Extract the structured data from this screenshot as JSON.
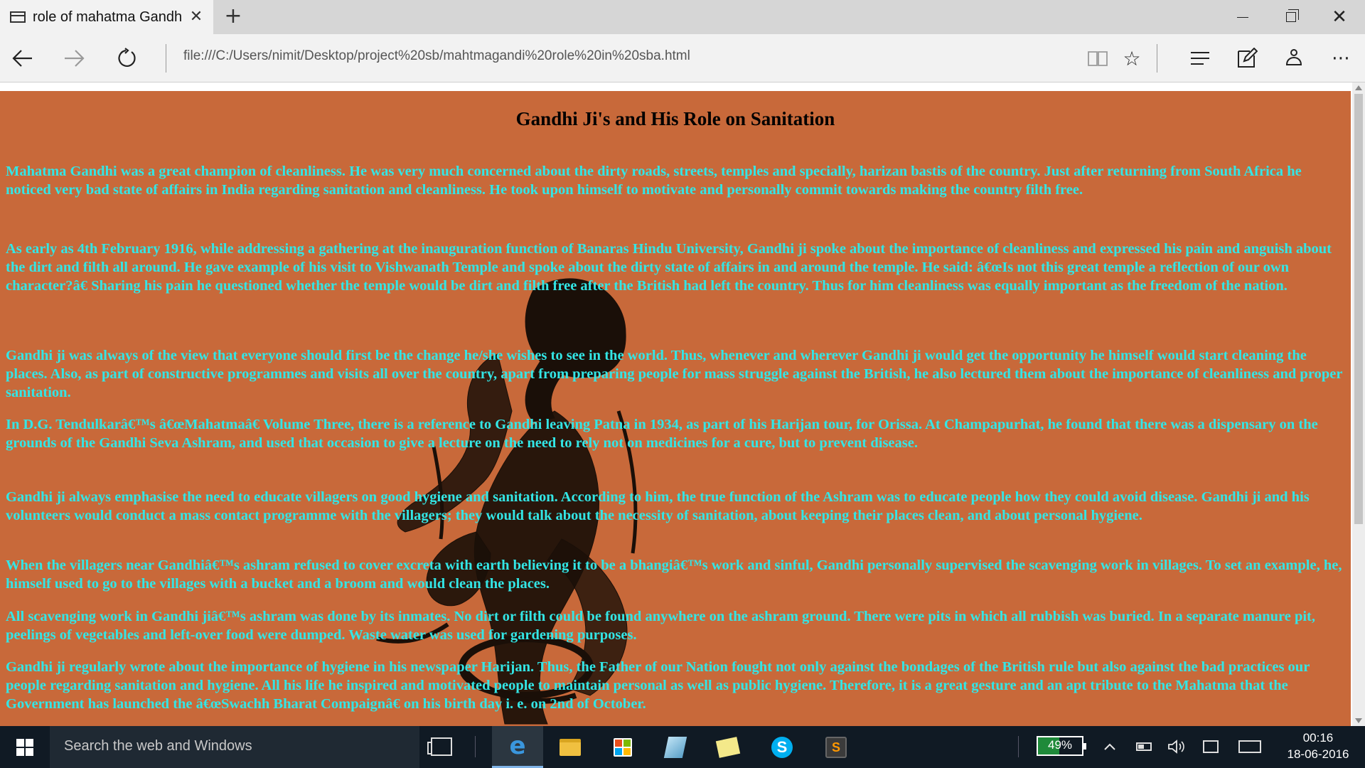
{
  "browser": {
    "tab_title": "role of mahatma Gandh",
    "tab_close_glyph": "✕",
    "new_tab_glyph": "+",
    "address": "file:///C:/Users/nimit/Desktop/project%20sb/mahtmagandi%20role%20in%20sba.html",
    "icons": [
      "page-icon",
      "back-arrow-icon",
      "forward-arrow-icon",
      "refresh-icon",
      "reading-view-icon",
      "star-icon",
      "hub-icon",
      "web-note-icon",
      "share-icon",
      "more-icon",
      "minimize-icon",
      "restore-icon",
      "close-icon"
    ]
  },
  "page": {
    "background": "#c8693a",
    "text_color": "#33e6e6",
    "title": "Gandhi Ji's and His Role on Sanitation",
    "paragraphs": [
      "Mahatma Gandhi was a great champion of cleanliness. He was very much concerned about the dirty roads, streets, temples and specially, harizan bastis of the country. Just after returning from South Africa he noticed very bad state of affairs in India regarding sanitation and cleanliness. He took upon himself to motivate and personally commit towards making the country filth free.",
      "As early as 4th February 1916, while addressing a gathering at the inauguration function of Banaras Hindu University, Gandhi ji spoke about the importance of cleanliness and expressed his pain and anguish about the dirt and filth all around. He gave example of his visit to Vishwanath Temple and spoke about the dirty state of affairs in and around the temple. He said: â€œIs not this great temple a reflection of our own character?â€ Sharing his pain he questioned whether the temple would be dirt and filth free after the British had left the country. Thus for him cleanliness was equally important as the freedom of the nation.",
      "Gandhi ji was always of the view that everyone should first be the change he/she wishes to see in the world. Thus, whenever and wherever Gandhi ji would get the opportunity he himself would start cleaning the places. Also, as part of constructive programmes and visits all over the country, apart from preparing people for mass struggle against the British, he also lectured them about the importance of cleanliness and proper sanitation.",
      "In D.G. Tendulkarâ€™s â€œMahatmaâ€ Volume Three, there is a reference to Gandhi leaving Patna in 1934, as part of his Harijan tour, for Orissa. At Champapurhat, he found that there was a dispensary on the grounds of the Gandhi Seva Ashram, and used that occasion to give a lecture on the need to rely not on medicines for a cure, but to prevent disease.",
      "Gandhi ji always emphasise the need to educate villagers on good hygiene and sanitation. According to him, the true function of the Ashram was to educate people how they could avoid disease. Gandhi ji and his volunteers would conduct a mass contact programme with the villagers; they would talk about the necessity of sanitation, about keeping their places clean, and about personal hygiene.",
      "When the villagers near Gandhiâ€™s ashram refused to cover excreta with earth believing it to be a bhangiâ€™s work and sinful, Gandhi personally supervised the scavenging work in villages. To set an example, he, himself used to go to the villages with a bucket and a broom and would clean the places.",
      "All scavenging work in Gandhi jiâ€™s ashram was done by its inmates. No dirt or filth could be found anywhere on the ashram ground. There were pits in which all rubbish was buried. In a separate manure pit, peelings of vegetables and left-over food were dumped. Waste water was used for gardening purposes.",
      "Gandhi ji regularly wrote about the importance of hygiene in his newspaper Harijan. Thus, the Father of our Nation fought not only against the bondages of the British rule but also against the bad practices our people regarding sanitation and hygiene. All his life he inspired and motivated people to maintain personal as well as public hygiene. Therefore, it is a great gesture and an apt tribute to the Mahatma that the Government has launched the â€œSwachh Bharat Compaignâ€ on his birth day i. e. on 2nd of October."
    ]
  },
  "taskbar": {
    "search_placeholder": "Search the web and Windows",
    "pinned_apps": [
      "edge-icon",
      "file-explorer-icon",
      "store-icon",
      "photos-icon",
      "sticky-notes-icon",
      "skype-icon",
      "sublime-text-icon"
    ],
    "battery_percent": "49%",
    "battery_level": 0.49,
    "time": "00:16",
    "date": "18-06-2016"
  }
}
